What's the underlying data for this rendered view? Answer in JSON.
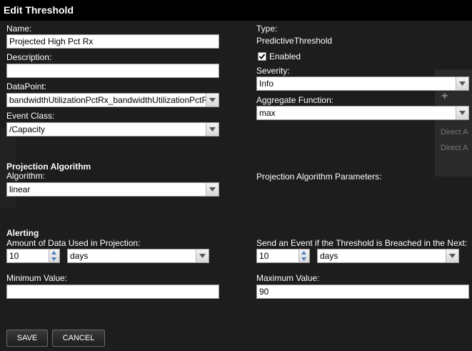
{
  "dialog": {
    "title": "Edit Threshold"
  },
  "background": {
    "direct_1": "Direct A",
    "direct_2": "Direct A"
  },
  "left": {
    "name_label": "Name:",
    "name_value": "Projected High Pct Rx",
    "description_label": "Description:",
    "description_value": "",
    "datapoint_label": "DataPoint:",
    "datapoint_value": "bandwidthUtilizationPctRx_bandwidthUtilizationPctR",
    "event_class_label": "Event Class:",
    "event_class_value": "/Capacity"
  },
  "right": {
    "type_label": "Type:",
    "type_value": "PredictiveThreshold",
    "enabled_label": "Enabled",
    "enabled_checked": true,
    "severity_label": "Severity:",
    "severity_value": "Info",
    "aggregate_label": "Aggregate Function:",
    "aggregate_value": "max"
  },
  "projection": {
    "section_title": "Projection Algorithm",
    "algorithm_label": "Algorithm:",
    "algorithm_value": "linear",
    "params_label": "Projection Algorithm Parameters:"
  },
  "alerting": {
    "section_title": "Alerting",
    "amount_label": "Amount of Data Used in Projection:",
    "amount_value": "10",
    "amount_unit": "days",
    "send_label": "Send an Event if the Threshold is Breached in the Next:",
    "send_value": "10",
    "send_unit": "days",
    "min_label": "Minimum Value:",
    "min_value": "",
    "max_label": "Maximum Value:",
    "max_value": "90"
  },
  "buttons": {
    "save": "SAVE",
    "cancel": "CANCEL"
  }
}
